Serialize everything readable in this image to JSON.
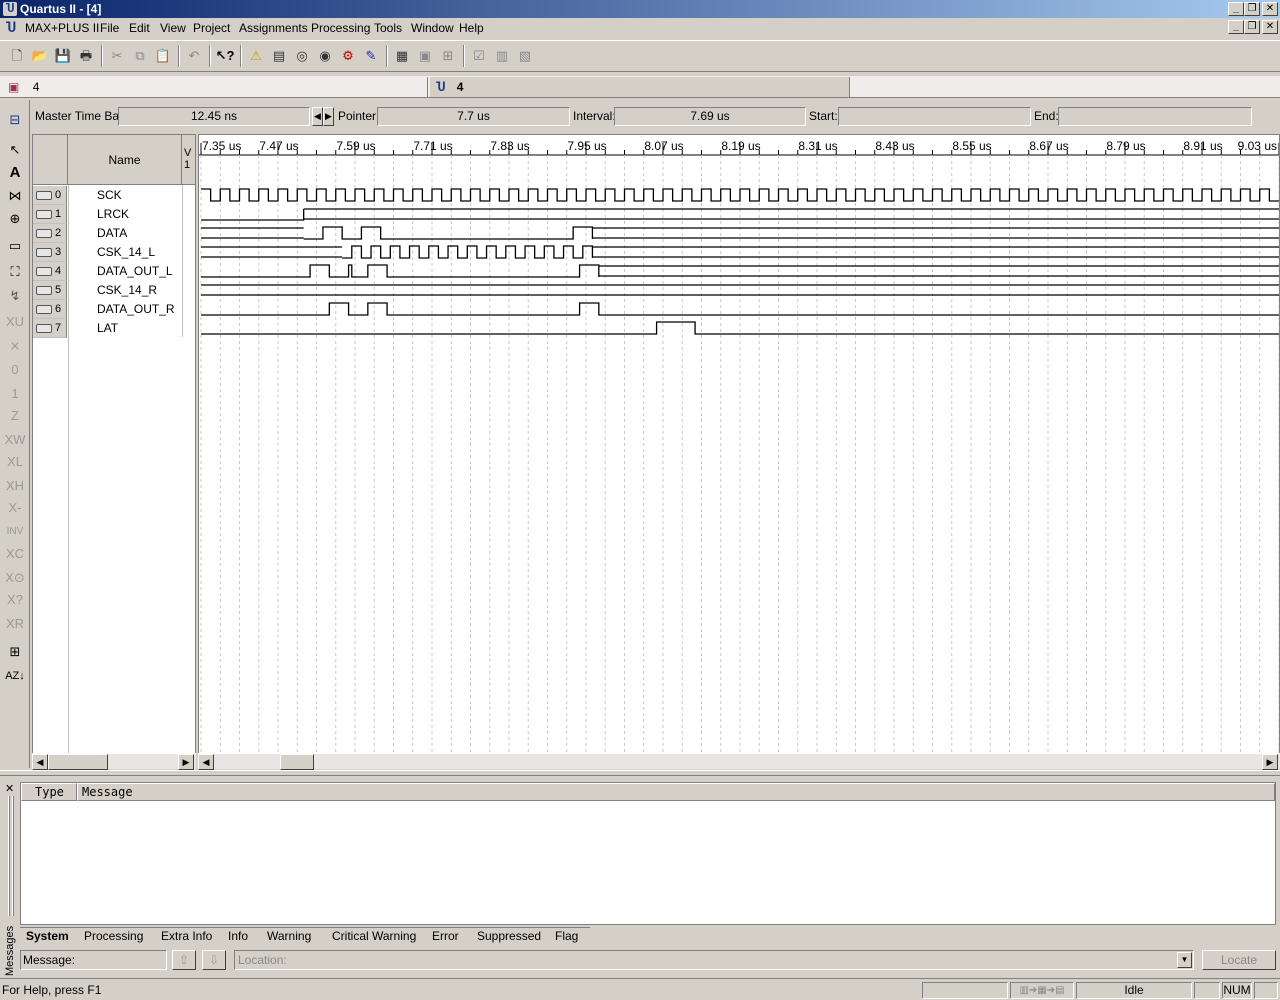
{
  "window": {
    "title": "Quartus II - [4]",
    "min_glyph": "_",
    "restore_glyph": "❐",
    "close_glyph": "✕"
  },
  "menu": {
    "items": [
      "MAX+PLUS II",
      "File",
      "Edit",
      "View",
      "Project",
      "Assignments",
      "Processing",
      "Tools",
      "Window",
      "Help"
    ]
  },
  "toolbar": {
    "icons": [
      "new-icon",
      "open-icon",
      "save-icon",
      "print-icon",
      "cut-icon",
      "copy-icon",
      "paste-icon",
      "undo-icon",
      "context-help-icon",
      "warning-icon",
      "compile-icon",
      "analysis-icon",
      "timing-icon",
      "simulate-icon",
      "programmer-icon",
      "report-icon",
      "settings-icon",
      "hierarchy-icon",
      "assignments-icon",
      "pins-icon",
      "floorplan-icon"
    ]
  },
  "doc_tabs": {
    "left_label": "4",
    "right_label": "4"
  },
  "timebar": {
    "master_label": "Master Time Bar:",
    "master_value": "12.45 ns",
    "pointer_label": "Pointer:",
    "pointer_value": "7.7 us",
    "interval_label": "Interval:",
    "interval_value": "7.69 us",
    "start_label": "Start:",
    "start_value": "",
    "end_label": "End:",
    "end_value": ""
  },
  "names_panel": {
    "header": "Name",
    "value_header": "V\n1",
    "signals": [
      {
        "index": "0",
        "name": "SCK",
        "dir": "in"
      },
      {
        "index": "1",
        "name": "LRCK",
        "dir": "in"
      },
      {
        "index": "2",
        "name": "DATA",
        "dir": "in"
      },
      {
        "index": "3",
        "name": "CSK_14_L",
        "dir": "out"
      },
      {
        "index": "4",
        "name": "DATA_OUT_L",
        "dir": "out"
      },
      {
        "index": "5",
        "name": "CSK_14_R",
        "dir": "out"
      },
      {
        "index": "6",
        "name": "DATA_OUT_R",
        "dir": "out"
      },
      {
        "index": "7",
        "name": "LAT",
        "dir": "out"
      }
    ]
  },
  "waveform": {
    "time_unit": "us",
    "t_start": 7.35,
    "t_end": 9.03,
    "ticks": [
      "7.35 us",
      "7.47 us",
      "7.59 us",
      "7.71 us",
      "7.83 us",
      "7.95 us",
      "8.07 us",
      "8.19 us",
      "8.31 us",
      "8.43 us",
      "8.55 us",
      "8.67 us",
      "8.79 us",
      "8.91 us",
      "9.03 us"
    ],
    "tick_values": [
      7.35,
      7.47,
      7.59,
      7.71,
      7.83,
      7.95,
      8.07,
      8.19,
      8.31,
      8.43,
      8.55,
      8.67,
      8.79,
      8.91,
      9.03
    ],
    "signals": [
      {
        "name": "SCK",
        "clock": true,
        "half_period_us": 0.015,
        "start_level": 1,
        "start_us": 7.35
      },
      {
        "name": "LRCK",
        "edges": [
          7.35,
          7.51
        ],
        "initial": 0,
        "final_bus": true
      },
      {
        "name": "DATA",
        "pulses": [
          [
            7.54,
            7.57
          ],
          [
            7.6,
            7.63
          ],
          [
            7.93,
            7.96
          ]
        ],
        "bus_after": 7.96,
        "bus_before": 7.51
      },
      {
        "name": "CSK_14_L",
        "clock_window": [
          7.57,
          7.96
        ],
        "half_period_us": 0.015,
        "bus_before": 7.57,
        "bus_after": 7.96
      },
      {
        "name": "DATA_OUT_L",
        "pulses": [
          [
            7.52,
            7.55
          ],
          [
            7.58,
            7.585
          ],
          [
            7.61,
            7.64
          ],
          [
            7.94,
            7.97
          ]
        ],
        "bus_after": 7.97
      },
      {
        "name": "CSK_14_R",
        "bus_full": true
      },
      {
        "name": "DATA_OUT_R",
        "pulses": [
          [
            7.55,
            7.58
          ],
          [
            7.61,
            7.64
          ],
          [
            7.94,
            7.97
          ]
        ]
      },
      {
        "name": "LAT",
        "pulses": [
          [
            8.06,
            8.12
          ]
        ]
      }
    ]
  },
  "messages": {
    "side_label": "Messages",
    "col_type": "Type",
    "col_message": "Message",
    "tabs": [
      "System",
      "Processing",
      "Extra Info",
      "Info",
      "Warning",
      "Critical Warning",
      "Error",
      "Suppressed",
      "Flag"
    ],
    "active_tab": "System",
    "message_label": "Message:",
    "location_placeholder": "Location:",
    "locate_label": "Locate"
  },
  "status": {
    "help_text": "For Help, press F1",
    "state": "Idle",
    "num": "NUM"
  }
}
